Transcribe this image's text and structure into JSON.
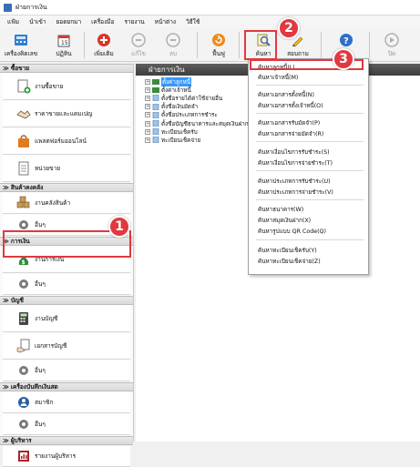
{
  "window": {
    "title": "ฝ่ายการเงิน"
  },
  "menubar": [
    "แฟ้ม",
    "นำเข้า",
    "ยอดยกมา",
    "เครื่องมือ",
    "รายงาน",
    "หน้าต่าง",
    "วิธีใช้"
  ],
  "toolbar": {
    "new_doc": "เครื่องคิดเลข",
    "calendar": "ปฏิทิน",
    "add": "เพิ่มเติม",
    "edit": "แก้ไข",
    "delete": "ลบ",
    "refresh": "ฟื้นฟู",
    "search": "ค้นหา",
    "query": "สอบถาม",
    "help": "",
    "close": "ปิด"
  },
  "sidebar": {
    "sections": [
      {
        "title": "ซื้อขาย",
        "items": [
          "งานซื้อขาย",
          "ราคาขายและแคมเปญ",
          "แพลตฟอร์มออนไลน์",
          "หน่วยขาย"
        ]
      },
      {
        "title": "สินค้าคงคลัง",
        "items": [
          "งานคลังสินค้า",
          "อื่นๆ"
        ]
      },
      {
        "title": "การเงิน",
        "items": [
          "งานการเงิน",
          "อื่นๆ"
        ]
      },
      {
        "title": "บัญชี",
        "items": [
          "งานบัญชี",
          "เอกสารบัญชี",
          "อื่นๆ"
        ]
      },
      {
        "title": "เครื่องบันทึกเงินสด",
        "items": [
          "สมาชิก",
          "อื่นๆ"
        ]
      },
      {
        "title": "ผู้บริหาร",
        "items": [
          "รายงานผู้บริหาร"
        ]
      }
    ]
  },
  "content": {
    "title": "ฝ่ายการเงิน",
    "tree": [
      "ตั้งค่าลูกหนี้",
      "ตั้งค่าเจ้าหนี้",
      "ตั้งชื่อรายได้ค่าใช้จ่ายอื่น",
      "ตั้งชื่อเงินมัดจำ",
      "ตั้งชื่อประเภทการชำระ",
      "ตั้งชื่อบัญชีธนาคารและสมุดเงินฝาก",
      "ทะเบียนเช็ครับ",
      "ทะเบียนเช็คจ่าย"
    ]
  },
  "dropdown": {
    "items": [
      "ค้นหาลูกหนี้(L)",
      "ค้นหาเจ้าหนี้(M)",
      "ค้นหาเอกสารตั้งหนี้(N)",
      "ค้นหาเอกสารตั้งเจ้าหนี้(O)",
      "ค้นหาเอกสารรับมัดจำ(P)",
      "ค้นหาเอกสารจ่ายมัดจำ(R)",
      "ค้นหาเงื่อนไขการรับชำระ(S)",
      "ค้นหาเงื่อนไขการจ่ายชำระ(T)",
      "ค้นหาประเภทการรับชำระ(U)",
      "ค้นหาประเภทการจ่ายชำระ(V)",
      "ค้นหาธนาคาร(W)",
      "ค้นหาสมุดเงินฝาก(X)",
      "ค้นหารูปแบบ QR Code(Q)",
      "ค้นหาทะเบียนเช็ครับ(Y)",
      "ค้นหาทะเบียนเช็คจ่าย(Z)"
    ]
  },
  "annotations": {
    "step1": "1",
    "step2": "2",
    "step3": "3",
    "color": "#e0393e"
  }
}
